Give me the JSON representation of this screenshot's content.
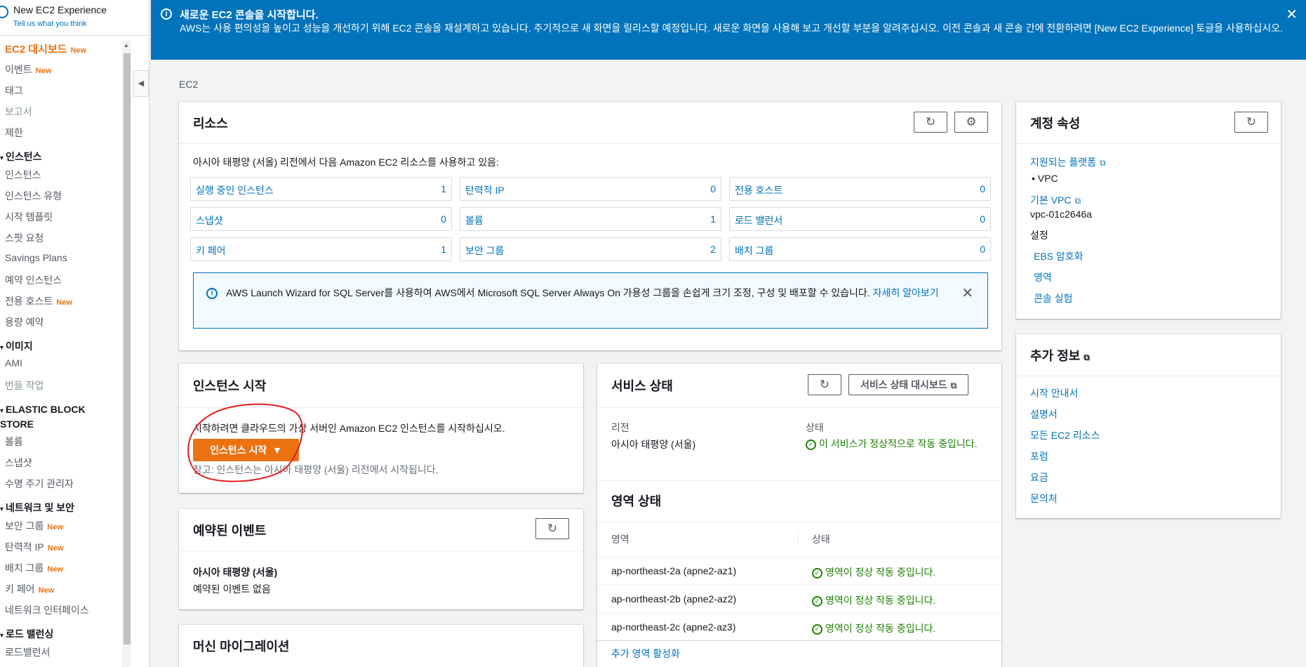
{
  "experience_toggle": {
    "label": "New EC2 Experience",
    "sub": "Tell us what you think"
  },
  "nav": {
    "dashboard": "EC2 대시보드",
    "events": "이벤트",
    "tags": "태그",
    "reports": "보고서",
    "limits": "제한",
    "sec_instances": "인스턴스",
    "instances": "인스턴스",
    "instance_types": "인스턴스 유형",
    "launch_templates": "시작 템플릿",
    "spot_requests": "스팟 요청",
    "savings_plans": "Savings Plans",
    "reserved_instances": "예약 인스턴스",
    "dedicated_hosts": "전용 호스트",
    "capacity_reservations": "용량 예약",
    "sec_images": "이미지",
    "ami": "AMI",
    "bundle_tasks": "번들 작업",
    "sec_ebs": "ELASTIC BLOCK STORE",
    "volumes": "볼륨",
    "snapshots": "스냅샷",
    "lifecycle_manager": "수명 주기 관리자",
    "sec_network": "네트워크 및 보안",
    "security_groups": "보안 그룹",
    "elastic_ips": "탄력적 IP",
    "placement_groups": "배치 그룹",
    "key_pairs": "키 페어",
    "network_interfaces": "네트워크 인터페이스",
    "sec_lb": "로드 밸런싱",
    "load_balancers": "로드밸런서",
    "new_badge": "New"
  },
  "banner": {
    "title": "새로운 EC2 콘솔을 시작합니다.",
    "body": "AWS는 사용 편의성을 높이고 성능을 개선하기 위해 EC2 콘솔을 재설계하고 있습니다. 주기적으로 새 화면을 릴리스할 예정입니다. 새로운 화면을 사용해 보고 개선할 부분을 알려주십시오. 이전 콘솔과 새 콘솔 간에 전환하려면 [New EC2 Experience] 토글을 사용하십시오."
  },
  "breadcrumb": "EC2",
  "resources": {
    "title": "리소스",
    "intro": "아시아 태평양 (서울) 리전에서 다음 Amazon EC2 리소스를 사용하고 있음:",
    "items": [
      {
        "label": "실행 중인 인스턴스",
        "count": "1"
      },
      {
        "label": "탄력적 IP",
        "count": "0"
      },
      {
        "label": "전용 호스트",
        "count": "0"
      },
      {
        "label": "스냅샷",
        "count": "0"
      },
      {
        "label": "볼륨",
        "count": "1"
      },
      {
        "label": "로드 밸런서",
        "count": "0"
      },
      {
        "label": "키 페어",
        "count": "1"
      },
      {
        "label": "보안 그룹",
        "count": "2"
      },
      {
        "label": "배치 그룹",
        "count": "0"
      }
    ],
    "alert_text": "AWS Launch Wizard for SQL Server를 사용하여 AWS에서 Microsoft SQL Server Always On 가용성 그룹을 손쉽게 크기 조정, 구성 및 배포할 수 있습니다.",
    "alert_link": "자세히 알아보기"
  },
  "account": {
    "title": "계정 속성",
    "supported_platforms": "지원되는 플랫폼",
    "platform_value": "VPC",
    "default_vpc": "기본 VPC",
    "vpc_id": "vpc-01c2646a",
    "settings": "설정",
    "ebs_encryption": "EBS 암호화",
    "zones": "영역",
    "console_experiments": "콘솔 실험"
  },
  "more_info": {
    "title": "추가 정보",
    "links": [
      "시작 안내서",
      "설명서",
      "모든 EC2 리소스",
      "포럼",
      "요금",
      "문의처"
    ]
  },
  "launch": {
    "title": "인스턴스 시작",
    "desc": "시작하려면 클라우드의 가상 서버인 Amazon EC2 인스턴스를 시작하십시오.",
    "button": "인스턴스 시작",
    "note": "참고: 인스턴스는 아시아 태평양 (서울) 리전에서 시작됩니다."
  },
  "events": {
    "title": "예약된 이벤트",
    "region": "아시아 태평양 (서울)",
    "none": "예약된 이벤트 없음"
  },
  "migration": {
    "title": "머신 마이그레이션"
  },
  "service": {
    "title": "서비스 상태",
    "dashboard_button": "서비스 상태 대시보드",
    "region_label": "리전",
    "region_value": "아시아 태평양 (서울)",
    "status_label": "상태",
    "status_value": "이 서비스가 정상적으로 작동 중입니다.",
    "zone_title": "영역 상태",
    "col_zone": "영역",
    "col_status": "상태",
    "zones": [
      {
        "name": "ap-northeast-2a (apne2-az1)",
        "status": "영역이 정상 작동 중입니다."
      },
      {
        "name": "ap-northeast-2b (apne2-az2)",
        "status": "영역이 정상 작동 중입니다."
      },
      {
        "name": "ap-northeast-2c (apne2-az3)",
        "status": "영역이 정상 작동 중입니다."
      }
    ],
    "activate_zone": "추가 영역 활성화"
  },
  "icons": {
    "refresh": "refresh-icon",
    "settings": "gear-icon",
    "external": "external-link-icon",
    "info": "info-icon",
    "close": "close-icon",
    "ok": "check-circle-icon"
  },
  "colors": {
    "accent": "#ec7211",
    "link": "#0073bb",
    "banner": "#0073bb",
    "success": "#1d8102"
  }
}
